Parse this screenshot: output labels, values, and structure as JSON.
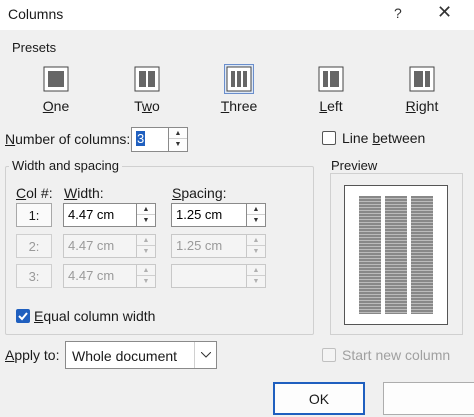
{
  "window": {
    "title": "Columns",
    "help_icon": "?",
    "close_icon": "✕"
  },
  "presets": {
    "label": "Presets",
    "items": [
      {
        "label": "One",
        "accel": "O",
        "rest": "ne",
        "selected": false
      },
      {
        "label": "Two",
        "accel": "w",
        "pre": "T",
        "rest": "o",
        "selected": false
      },
      {
        "label": "Three",
        "accel": "T",
        "rest": "hree",
        "selected": true
      },
      {
        "label": "Left",
        "accel": "L",
        "rest": "eft",
        "selected": false
      },
      {
        "label": "Right",
        "accel": "R",
        "rest": "ight",
        "selected": false
      }
    ]
  },
  "num_columns": {
    "label_accel": "N",
    "label_rest": "umber of columns:",
    "value": "3"
  },
  "line_between": {
    "label_pre": "Line ",
    "label_accel": "b",
    "label_rest": "etween",
    "checked": false
  },
  "width_spacing": {
    "label": "Width and spacing",
    "col_header_accel": "C",
    "col_header_rest": "ol #:",
    "width_header_accel": "W",
    "width_header_rest": "idth:",
    "spacing_header_accel": "S",
    "spacing_header_rest": "pacing:",
    "rows": [
      {
        "col": "1:",
        "width": "4.47 cm",
        "spacing": "1.25 cm",
        "enabled": true
      },
      {
        "col": "2:",
        "width": "4.47 cm",
        "spacing": "1.25 cm",
        "enabled": false
      },
      {
        "col": "3:",
        "width": "4.47 cm",
        "spacing": "",
        "enabled": false
      }
    ]
  },
  "equal_width": {
    "label_accel": "E",
    "label_rest": "qual column width",
    "checked": true
  },
  "preview": {
    "label": "Preview",
    "columns": 3
  },
  "apply_to": {
    "label_accel": "A",
    "label_rest": "pply to:",
    "value": "Whole document"
  },
  "start_new_column": {
    "label": "Start new column",
    "checked": false,
    "enabled": false
  },
  "buttons": {
    "ok": "OK"
  },
  "colors": {
    "accent": "#1f5fbf"
  }
}
